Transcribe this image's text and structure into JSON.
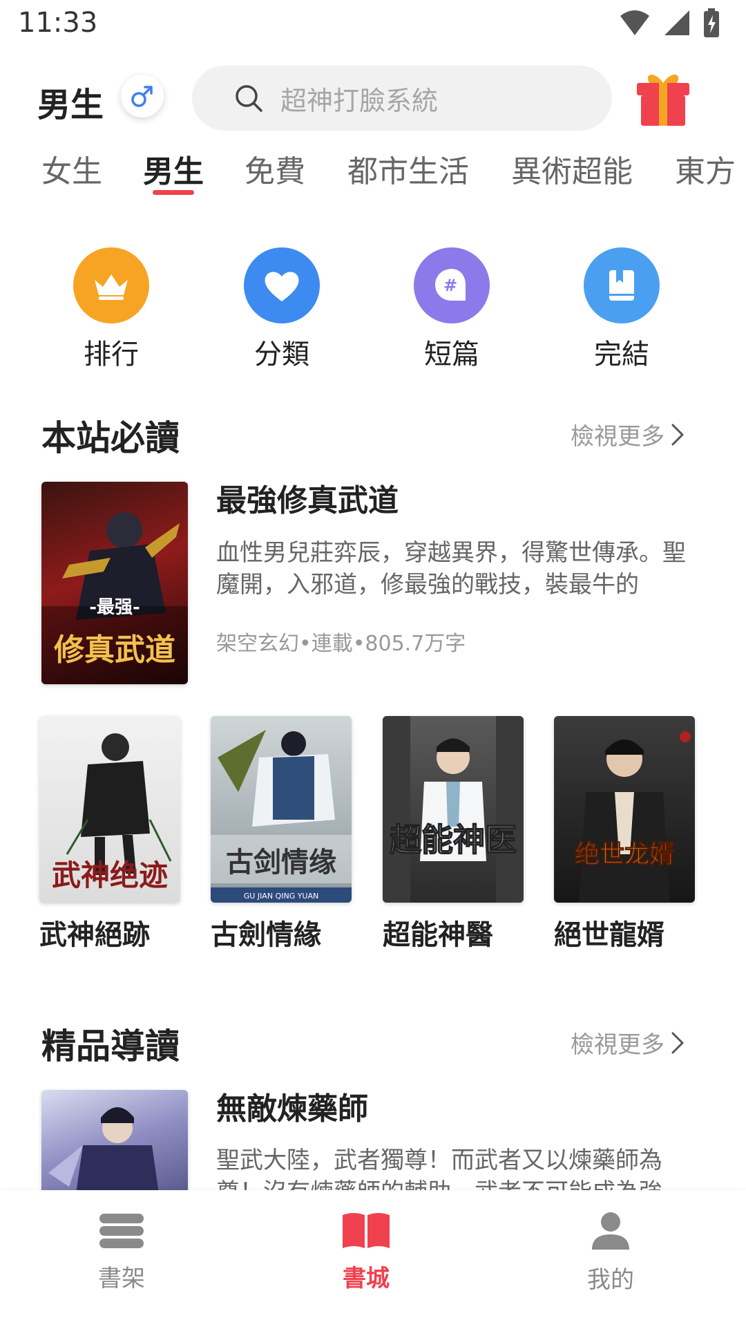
{
  "status": {
    "time": "11:33"
  },
  "header": {
    "gender_label": "男生",
    "search_placeholder": "超神打臉系統"
  },
  "tabs": [
    {
      "label": "女生"
    },
    {
      "label": "男生"
    },
    {
      "label": "免費"
    },
    {
      "label": "都市生活"
    },
    {
      "label": "異術超能"
    },
    {
      "label": "東方"
    }
  ],
  "quick_links": [
    {
      "label": "排行",
      "icon": "crown-icon",
      "color": "#f7a425"
    },
    {
      "label": "分類",
      "icon": "heart-icon",
      "color": "#3d8bf0"
    },
    {
      "label": "短篇",
      "icon": "hashtag-chat-icon",
      "color": "#8c79ea"
    },
    {
      "label": "完結",
      "icon": "book-icon",
      "color": "#4b9ff0"
    }
  ],
  "section1": {
    "title": "本站必讀",
    "more": "檢視更多",
    "featured": {
      "title": "最強修真武道",
      "desc": "血性男兒莊弈辰，穿越異界，得驚世傳承。聖魔開，入邪道，修最強的戰技，裝最牛的",
      "meta": "架空玄幻•連載•805.7万字",
      "cover_text_top": "-最强-",
      "cover_text_main": "修真武道"
    },
    "books": [
      {
        "title": "武神絕跡",
        "cover_text": "武神绝迹"
      },
      {
        "title": "古劍情緣",
        "cover_text": "古剑情缘",
        "cover_sub": "GU JIAN QING YUAN"
      },
      {
        "title": "超能神醫",
        "cover_text": "超能神医"
      },
      {
        "title": "絕世龍婿",
        "cover_text": "绝世龙婿"
      }
    ]
  },
  "section2": {
    "title": "精品導讀",
    "more": "檢視更多",
    "featured": {
      "title": "無敵煉藥師",
      "desc": "聖武大陸，武者獨尊！而武者又以煉藥師為尊！沒有煉藥師的輔助，武者不可能成為強"
    }
  },
  "bottom_nav": [
    {
      "label": "書架",
      "icon": "bookshelf-icon",
      "color": "#8a8a8a"
    },
    {
      "label": "書城",
      "icon": "open-book-icon",
      "color": "#f0414f"
    },
    {
      "label": "我的",
      "icon": "person-icon",
      "color": "#8a8a8a"
    }
  ],
  "colors": {
    "accent": "#f0414f",
    "search_bg": "#f1f1f1"
  }
}
